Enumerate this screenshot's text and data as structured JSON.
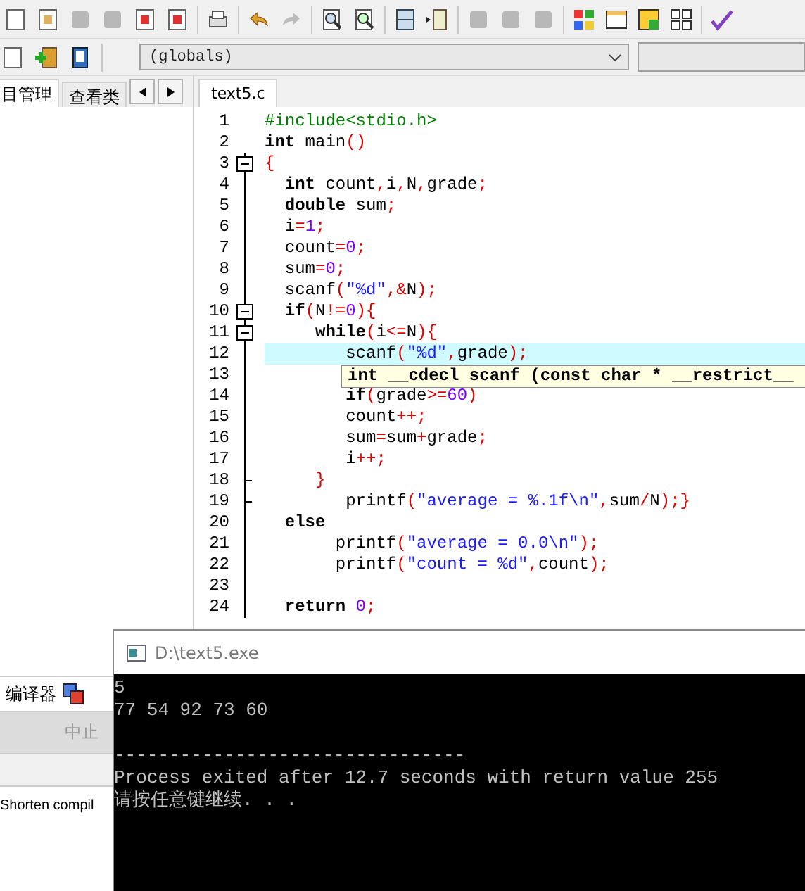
{
  "toolbar2": {
    "scope_select": {
      "value": "(globals)"
    }
  },
  "left_tabs": [
    {
      "label": "目管理",
      "selected": true
    },
    {
      "label": "查看类",
      "selected": false
    }
  ],
  "editor_tabs": [
    {
      "label": "text5.c",
      "selected": true
    }
  ],
  "code_lines": [
    {
      "number": "1",
      "kind": "top",
      "highlight": false,
      "tokens": [
        {
          "kind": "pp",
          "text": "#include<stdio.h>"
        }
      ]
    },
    {
      "number": "2",
      "kind": "top",
      "highlight": false,
      "tokens": [
        {
          "kind": "kw",
          "text": "int"
        },
        {
          "kind": "plain",
          "text": " main"
        },
        {
          "kind": "sym",
          "text": "()"
        }
      ]
    },
    {
      "number": "3",
      "kind": "start",
      "highlight": false,
      "tokens": [
        {
          "kind": "sym",
          "text": "{"
        }
      ]
    },
    {
      "number": "4",
      "kind": "body",
      "highlight": false,
      "tokens": [
        {
          "kind": "kw",
          "text": "  int"
        },
        {
          "kind": "plain",
          "text": " count"
        },
        {
          "kind": "sym",
          "text": ","
        },
        {
          "kind": "plain",
          "text": "i"
        },
        {
          "kind": "sym",
          "text": ","
        },
        {
          "kind": "plain",
          "text": "N"
        },
        {
          "kind": "sym",
          "text": ","
        },
        {
          "kind": "plain",
          "text": "grade"
        },
        {
          "kind": "sym",
          "text": ";"
        }
      ]
    },
    {
      "number": "5",
      "kind": "body",
      "highlight": false,
      "tokens": [
        {
          "kind": "kw",
          "text": "  double"
        },
        {
          "kind": "plain",
          "text": " sum"
        },
        {
          "kind": "sym",
          "text": ";"
        }
      ]
    },
    {
      "number": "6",
      "kind": "body",
      "highlight": false,
      "tokens": [
        {
          "kind": "plain",
          "text": "  i"
        },
        {
          "kind": "sym",
          "text": "="
        },
        {
          "kind": "num",
          "text": "1"
        },
        {
          "kind": "sym",
          "text": ";"
        }
      ]
    },
    {
      "number": "7",
      "kind": "body",
      "highlight": false,
      "tokens": [
        {
          "kind": "plain",
          "text": "  count"
        },
        {
          "kind": "sym",
          "text": "="
        },
        {
          "kind": "num",
          "text": "0"
        },
        {
          "kind": "sym",
          "text": ";"
        }
      ]
    },
    {
      "number": "8",
      "kind": "body",
      "highlight": false,
      "tokens": [
        {
          "kind": "plain",
          "text": "  sum"
        },
        {
          "kind": "sym",
          "text": "="
        },
        {
          "kind": "num",
          "text": "0"
        },
        {
          "kind": "sym",
          "text": ";"
        }
      ]
    },
    {
      "number": "9",
      "kind": "body",
      "highlight": false,
      "tokens": [
        {
          "kind": "plain",
          "text": "  scanf"
        },
        {
          "kind": "sym",
          "text": "("
        },
        {
          "kind": "str",
          "text": "\"%d\""
        },
        {
          "kind": "sym",
          "text": ",&"
        },
        {
          "kind": "plain",
          "text": "N"
        },
        {
          "kind": "sym",
          "text": ");"
        }
      ]
    },
    {
      "number": "10",
      "kind": "start",
      "highlight": false,
      "tokens": [
        {
          "kind": "kw",
          "text": "  if"
        },
        {
          "kind": "sym",
          "text": "("
        },
        {
          "kind": "plain",
          "text": "N"
        },
        {
          "kind": "sym",
          "text": "!="
        },
        {
          "kind": "num",
          "text": "0"
        },
        {
          "kind": "sym",
          "text": "){"
        }
      ]
    },
    {
      "number": "11",
      "kind": "start",
      "highlight": false,
      "tokens": [
        {
          "kind": "kw",
          "text": "     while"
        },
        {
          "kind": "sym",
          "text": "("
        },
        {
          "kind": "plain",
          "text": "i"
        },
        {
          "kind": "sym",
          "text": "<="
        },
        {
          "kind": "plain",
          "text": "N"
        },
        {
          "kind": "sym",
          "text": "){"
        }
      ]
    },
    {
      "number": "12",
      "kind": "body",
      "highlight": true,
      "tokens": [
        {
          "kind": "plain",
          "text": "        scanf"
        },
        {
          "kind": "sym",
          "text": "("
        },
        {
          "kind": "str",
          "text": "\"%d\""
        },
        {
          "kind": "sym",
          "text": ","
        },
        {
          "kind": "plain",
          "text": "grade"
        },
        {
          "kind": "sym",
          "text": ");"
        }
      ]
    },
    {
      "number": "13",
      "kind": "body",
      "highlight": false
    },
    {
      "number": "14",
      "kind": "body",
      "highlight": false,
      "tokens": [
        {
          "kind": "kw",
          "text": "        if"
        },
        {
          "kind": "sym",
          "text": "("
        },
        {
          "kind": "plain",
          "text": "grade"
        },
        {
          "kind": "sym",
          "text": ">="
        },
        {
          "kind": "num",
          "text": "60"
        },
        {
          "kind": "sym",
          "text": ")"
        }
      ]
    },
    {
      "number": "15",
      "kind": "body",
      "highlight": false,
      "tokens": [
        {
          "kind": "plain",
          "text": "        count"
        },
        {
          "kind": "sym",
          "text": "++;"
        }
      ]
    },
    {
      "number": "16",
      "kind": "body",
      "highlight": false,
      "tokens": [
        {
          "kind": "plain",
          "text": "        sum"
        },
        {
          "kind": "sym",
          "text": "="
        },
        {
          "kind": "plain",
          "text": "sum"
        },
        {
          "kind": "sym",
          "text": "+"
        },
        {
          "kind": "plain",
          "text": "grade"
        },
        {
          "kind": "sym",
          "text": ";"
        }
      ]
    },
    {
      "number": "17",
      "kind": "body",
      "highlight": false,
      "tokens": [
        {
          "kind": "plain",
          "text": "        i"
        },
        {
          "kind": "sym",
          "text": "++;"
        }
      ]
    },
    {
      "number": "18",
      "kind": "end",
      "highlight": false,
      "tokens": [
        {
          "kind": "sym",
          "text": "     }"
        }
      ]
    },
    {
      "number": "19",
      "kind": "end",
      "highlight": false,
      "tokens": [
        {
          "kind": "plain",
          "text": "        printf"
        },
        {
          "kind": "sym",
          "text": "("
        },
        {
          "kind": "str",
          "text": "\"average = %.1f\\n\""
        },
        {
          "kind": "sym",
          "text": ","
        },
        {
          "kind": "plain",
          "text": "sum"
        },
        {
          "kind": "sym",
          "text": "/"
        },
        {
          "kind": "plain",
          "text": "N"
        },
        {
          "kind": "sym",
          "text": ");}"
        }
      ]
    },
    {
      "number": "20",
      "kind": "body",
      "highlight": false,
      "tokens": [
        {
          "kind": "kw",
          "text": "  else"
        }
      ]
    },
    {
      "number": "21",
      "kind": "body",
      "highlight": false,
      "tokens": [
        {
          "kind": "plain",
          "text": "       printf"
        },
        {
          "kind": "sym",
          "text": "("
        },
        {
          "kind": "str",
          "text": "\"average = 0.0\\n\""
        },
        {
          "kind": "sym",
          "text": ");"
        }
      ]
    },
    {
      "number": "22",
      "kind": "body",
      "highlight": false,
      "tokens": [
        {
          "kind": "plain",
          "text": "       printf"
        },
        {
          "kind": "sym",
          "text": "("
        },
        {
          "kind": "str",
          "text": "\"count = %d\""
        },
        {
          "kind": "sym",
          "text": ","
        },
        {
          "kind": "plain",
          "text": "count"
        },
        {
          "kind": "sym",
          "text": ");"
        }
      ]
    },
    {
      "number": "23",
      "kind": "body",
      "highlight": false
    },
    {
      "number": "24",
      "kind": "body",
      "highlight": false,
      "tokens": [
        {
          "kind": "kw",
          "text": "  return"
        },
        {
          "kind": "num",
          "text": " 0"
        },
        {
          "kind": "sym",
          "text": ";"
        }
      ]
    }
  ],
  "tooltip": {
    "text": "int __cdecl scanf (const char * __restrict__"
  },
  "bottom_panel": {
    "tab": "编译器",
    "abort_button": {
      "label": "中止",
      "disabled": true
    },
    "hint": "Shorten compil"
  },
  "console": {
    "title": "D:\\text5.exe",
    "output": [
      "5",
      "77 54 92 73 60"
    ],
    "footer": [
      "--------------------------------",
      "Process exited after 12.7 seconds with return value 255",
      "请按任意键继续. . ."
    ]
  }
}
